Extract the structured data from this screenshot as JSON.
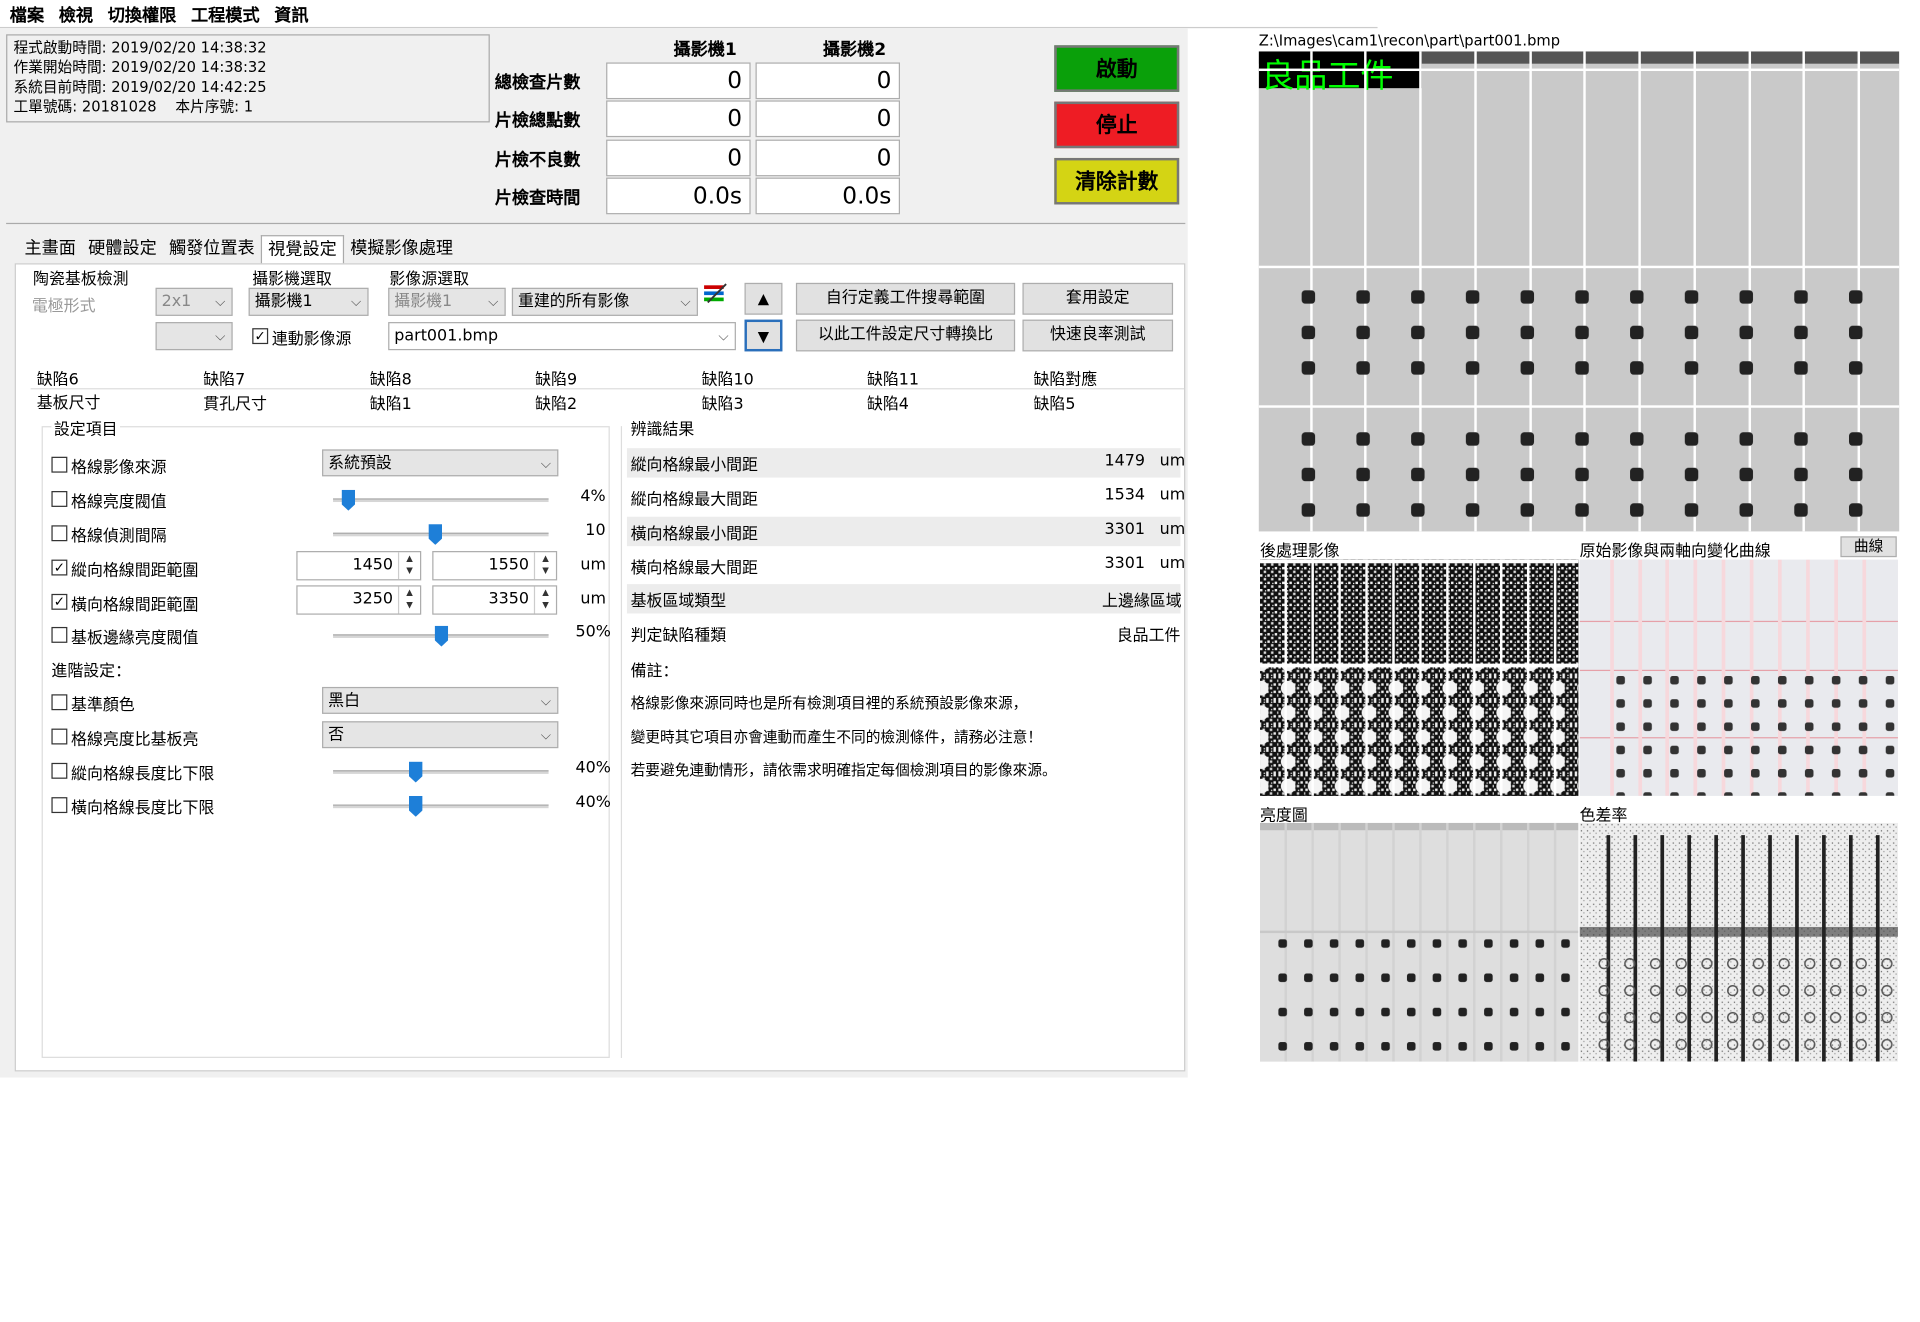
{
  "menu": [
    "檔案",
    "檢視",
    "切換權限",
    "工程模式",
    "資訊"
  ],
  "info": {
    "line1": "程式啟動時間: 2019/02/20 14:38:32",
    "line2": "作業開始時間: 2019/02/20 14:38:32",
    "line3": "系統目前時間: 2019/02/20 14:42:25",
    "line4": "工單號碼: 20181028    本片序號: 1"
  },
  "stats": {
    "cam1": "攝影機1",
    "cam2": "攝影機2",
    "rows": [
      {
        "label": "總檢查片數",
        "v1": "0",
        "v2": "0"
      },
      {
        "label": "片檢總點數",
        "v1": "0",
        "v2": "0"
      },
      {
        "label": "片檢不良數",
        "v1": "0",
        "v2": "0"
      },
      {
        "label": "片檢查時間",
        "v1": "0.0s",
        "v2": "0.0s"
      }
    ]
  },
  "controls": {
    "start": "啟動",
    "stop": "停止",
    "clear": "清除計數",
    "start_color": "#0aa00a",
    "stop_color": "#ee1c24",
    "clear_color": "#d4d414"
  },
  "tabs": [
    "主畫面",
    "硬體設定",
    "觸發位置表",
    "視覺設定",
    "模擬影像處理"
  ],
  "settings": {
    "group1": "陶瓷基板檢測",
    "electrode_label": "電極形式",
    "electrode_value": "2x1",
    "group2": "攝影機選取",
    "camera_value": "攝影機1",
    "link_label": "連動影像源",
    "group3": "影像源選取",
    "src_camera": "攝影機1",
    "src_type": "重建的所有影像",
    "src_file": "part001.bmp",
    "btn_custom": "自行定義工件搜尋範圍",
    "btn_apply": "套用設定",
    "btn_convert": "以此工件設定尺寸轉換比",
    "btn_quick": "快速良率測試",
    "up": "▲",
    "down": "▼"
  },
  "defect_tabs_row1": [
    "缺陷6",
    "缺陷7",
    "缺陷8",
    "缺陷9",
    "缺陷10",
    "缺陷11",
    "缺陷對應"
  ],
  "defect_tabs_row2": [
    "基板尺寸",
    "貫孔尺寸",
    "缺陷1",
    "缺陷2",
    "缺陷3",
    "缺陷4",
    "缺陷5"
  ],
  "setting_items": {
    "title": "設定項目",
    "line_src": "格線影像來源",
    "line_src_val": "系統預設",
    "line_bright": "格線亮度閥值",
    "line_bright_pct": "4%",
    "line_gap": "格線偵測間隔",
    "line_gap_val": "10",
    "v_range": "縱向格線間距範圍",
    "v_min": "1450",
    "v_max": "1550",
    "h_range": "橫向格線間距範圍",
    "h_min": "3250",
    "h_max": "3350",
    "unit": "um",
    "edge_bright": "基板邊緣亮度閥值",
    "edge_pct": "50%",
    "adv": "進階設定：",
    "base_color": "基準顏色",
    "base_color_val": "黑白",
    "brighter": "格線亮度比基板亮",
    "brighter_val": "否",
    "v_len": "縱向格線長度比下限",
    "v_len_pct": "40%",
    "h_len": "橫向格線長度比下限",
    "h_len_pct": "40%",
    "slider_line_bright": 0.04,
    "slider_line_gap": 0.47,
    "slider_edge": 0.5,
    "slider_vlen": 0.4,
    "slider_hlen": 0.4
  },
  "results": {
    "title": "辨識結果",
    "rows": [
      {
        "label": "縱向格線最小間距",
        "value": "1479",
        "unit": "um"
      },
      {
        "label": "縱向格線最大間距",
        "value": "1534",
        "unit": "um"
      },
      {
        "label": "橫向格線最小間距",
        "value": "3301",
        "unit": "um"
      },
      {
        "label": "橫向格線最大間距",
        "value": "3301",
        "unit": "um"
      },
      {
        "label": "基板區域類型",
        "value": "上邊緣區域",
        "unit": ""
      },
      {
        "label": "判定缺陷種類",
        "value": "良品工件",
        "unit": ""
      }
    ],
    "note_title": "備註：",
    "note1": "格線影像來源同時也是所有檢測項目裡的系統預設影像來源，",
    "note2": "變更時其它項目亦會連動而產生不同的檢測條件，請務必注意！",
    "note3": "若要避免連動情形，請依需求明確指定每個檢測項目的影像來源。"
  },
  "images": {
    "path": "Z:\\Images\\cam1\\recon\\part\\part001.bmp",
    "overlay": "良品工件",
    "post": "後處理影像",
    "orig": "原始影像與兩軸向變化曲線",
    "curve_btn": "曲線",
    "lum": "亮度圖",
    "diff": "色差率"
  }
}
